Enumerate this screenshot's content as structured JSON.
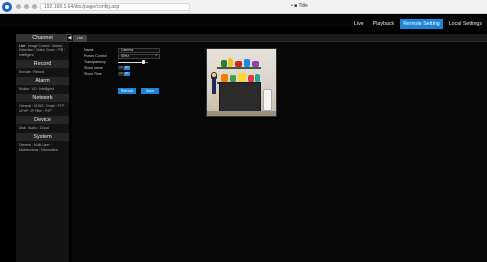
{
  "browser": {
    "url": "192.168.1.64/doc/page/config.asp",
    "tab_label": "• ■ Title"
  },
  "topnav": {
    "items": [
      {
        "label": "Live",
        "active": false
      },
      {
        "label": "Playback",
        "active": false
      },
      {
        "label": "Remote Setting",
        "active": true
      },
      {
        "label": "Local Settings",
        "active": false
      }
    ],
    "accent": "#1d84d8"
  },
  "sidebar": {
    "sections": [
      {
        "title": "Channel",
        "items": [
          "Live",
          "Image Control",
          "Motion Detection",
          "Video Cover",
          "PIR",
          "Intelligent"
        ]
      },
      {
        "title": "Record",
        "items": [
          "Encode",
          "Record"
        ]
      },
      {
        "title": "Alarm",
        "items": [
          "Motion",
          "I/O",
          "Intelligent"
        ]
      },
      {
        "title": "Network",
        "items": [
          "General",
          "DDNS",
          "Email",
          "FTP",
          "UPnP",
          "IP Filter",
          "P2P"
        ]
      },
      {
        "title": "Device",
        "items": [
          "Disk",
          "Audio",
          "Cloud"
        ]
      },
      {
        "title": "System",
        "items": [
          "General",
          "Multi-User",
          "Maintenance",
          "Information"
        ]
      }
    ],
    "collapse_icon": "chevron-left-icon"
  },
  "content": {
    "tab_label": "Live",
    "form": {
      "name_label": "Name",
      "name_value": "Camera",
      "power_label": "Power Control",
      "power_value": "50Hz",
      "transparency_label": "Transparency",
      "transparency_value": 0.85,
      "show_name_label": "Show name",
      "show_time_label": "Show Time",
      "toggle_off": "Off",
      "toggle_on": "On"
    },
    "buttons": {
      "refresh": "Refresh",
      "save": "Save"
    }
  }
}
